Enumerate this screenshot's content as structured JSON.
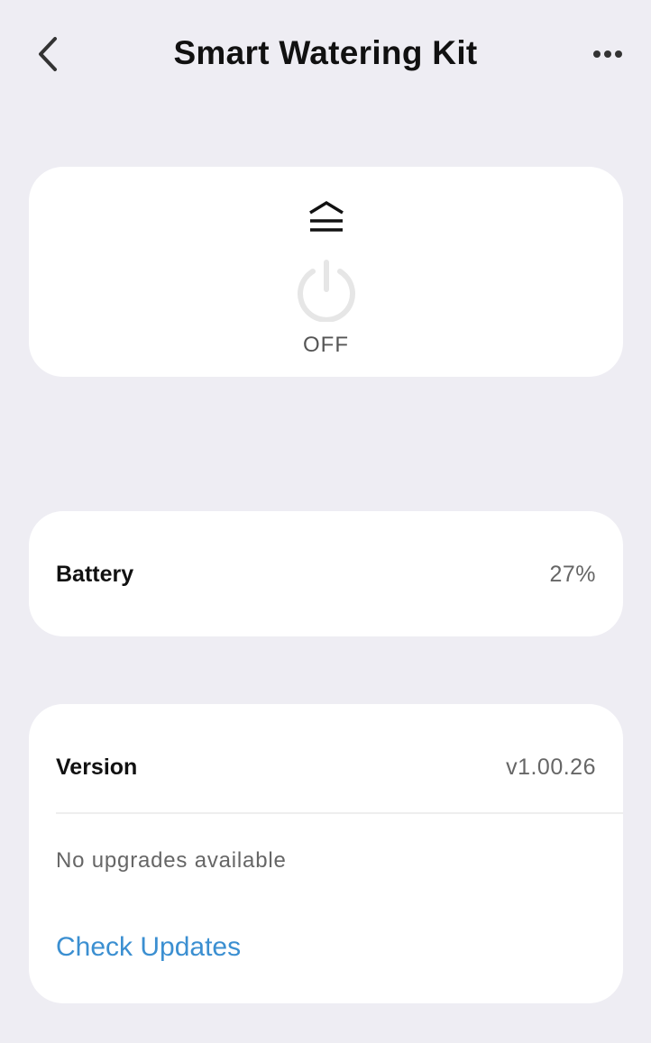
{
  "header": {
    "title": "Smart Watering Kit",
    "back_icon": "chevron-left-icon",
    "more_icon": "more-horizontal-icon"
  },
  "power_card": {
    "mode_icon": "water-level-icon",
    "power_icon": "power-icon",
    "status": "OFF"
  },
  "battery": {
    "label": "Battery",
    "value": "27%"
  },
  "version": {
    "label": "Version",
    "value": "v1.00.26",
    "upgrade_status": "No upgrades available",
    "check_updates_label": "Check Updates"
  },
  "colors": {
    "background": "#eeedf3",
    "card": "#ffffff",
    "link": "#3b8fd1",
    "power_off": "#e6e6e6"
  }
}
